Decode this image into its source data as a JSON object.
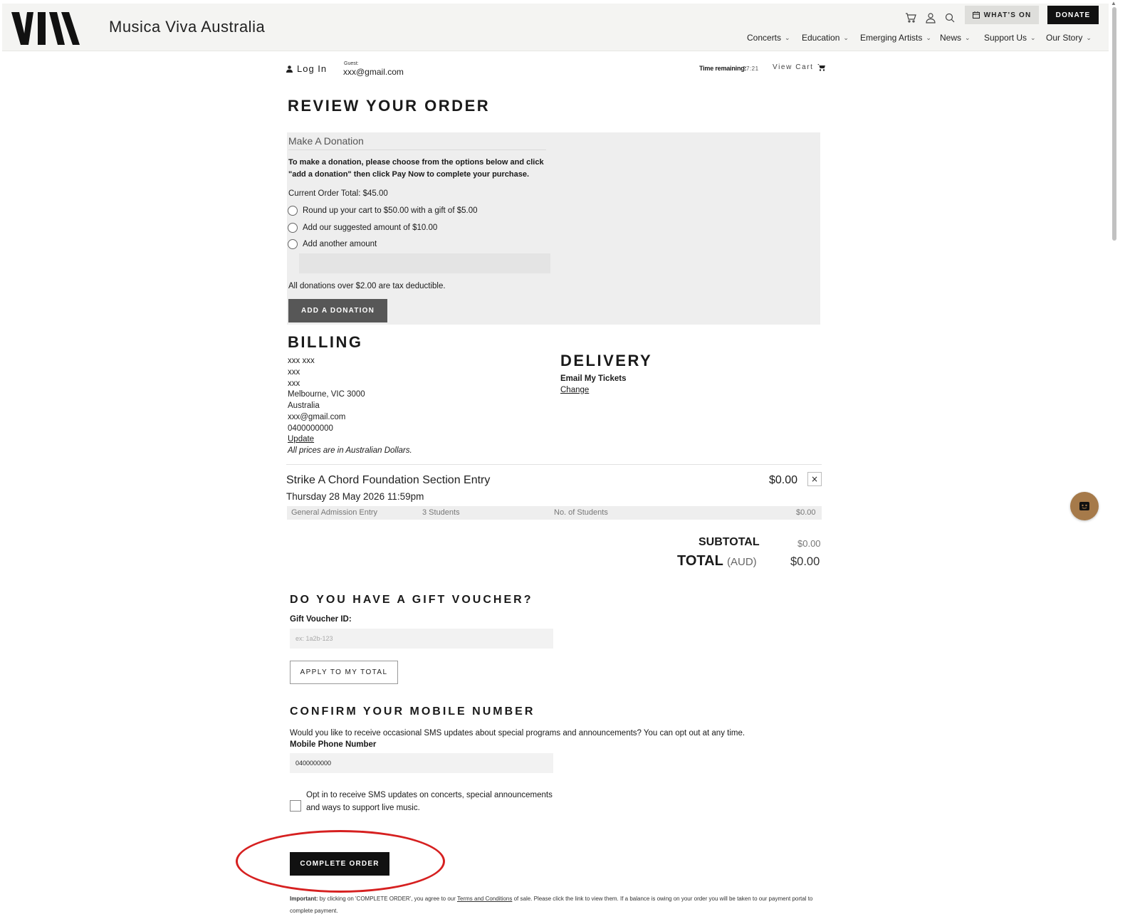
{
  "header": {
    "brand_name": "Musica Viva Australia",
    "whats_on_label": "WHAT'S ON",
    "donate_label": "DONATE",
    "nav": [
      {
        "label": "Concerts"
      },
      {
        "label": "Education"
      },
      {
        "label": "Emerging Artists"
      },
      {
        "label": "News"
      },
      {
        "label": "Support Us"
      },
      {
        "label": "Our Story"
      }
    ],
    "icons": [
      "cart-icon",
      "user-icon",
      "search-icon",
      "calendar-icon"
    ]
  },
  "account": {
    "login_label": "Log In",
    "guest_label": "Guest:",
    "guest_email": "xxx@gmail.com",
    "time_label": "Time remaining:",
    "time_value": "27:21",
    "view_cart_label": "View Cart"
  },
  "page_title": "REVIEW YOUR ORDER",
  "donation": {
    "heading": "Make A Donation",
    "instructions": "To make a donation, please choose from the options below and click \"add a donation\" then click Pay Now to complete your purchase.",
    "current_total": "Current Order Total: $45.00",
    "options": [
      "Round up your cart to $50.00 with a gift of $5.00",
      "Add our suggested amount of $10.00",
      "Add another amount"
    ],
    "other_amount_value": "",
    "tax_note": "All donations over $2.00 are tax deductible.",
    "button_label": "ADD A DONATION"
  },
  "billing": {
    "heading": "BILLING",
    "lines": [
      "xxx xxx",
      "xxx",
      "xxx",
      "Melbourne, VIC 3000",
      "Australia",
      "xxx@gmail.com",
      "0400000000"
    ],
    "update_label": "Update",
    "price_note": "All prices are in Australian Dollars."
  },
  "delivery": {
    "heading": "DELIVERY",
    "method": "Email My Tickets",
    "change_label": "Change"
  },
  "cart_item": {
    "title": "Strike A Chord Foundation Section Entry",
    "date": "Thursday 28 May 2026 11:59pm",
    "price": "$0.00",
    "remove_symbol": "×",
    "ticket_row": {
      "type": "General Admission Entry",
      "quantity": "3 Students",
      "category": "No. of Students",
      "price": "$0.00"
    }
  },
  "totals": {
    "subtotal_label": "SUBTOTAL",
    "subtotal_value": "$0.00",
    "total_label": "TOTAL",
    "currency": "(AUD)",
    "total_value": "$0.00"
  },
  "voucher": {
    "heading": "DO YOU HAVE A GIFT VOUCHER?",
    "label": "Gift Voucher ID:",
    "placeholder": "ex: 1a2b-123",
    "apply_label": "APPLY TO MY TOTAL"
  },
  "mobile": {
    "heading": "CONFIRM YOUR MOBILE NUMBER",
    "question": "Would you like to receive occasional SMS updates about special programs and announcements? You can opt out at any time.",
    "field_label": "Mobile Phone Number",
    "value": "0400000000",
    "optin_text": "Opt in to receive SMS updates on concerts, special announcements and ways to support live music."
  },
  "complete_order_label": "COMPLETE ORDER",
  "legal": {
    "important": "Important:",
    "text_before": " by clicking on 'COMPLETE ORDER', you agree to our ",
    "terms_link": "Terms and Conditions",
    "text_after": " of sale. Please click the link to view them. If a balance is owing on your order you will be taken to our payment portal to complete payment."
  },
  "colors": {
    "accent_dark": "#111111",
    "donation_bg": "#eeeeee",
    "highlight_ring": "#d62020",
    "chat_widget": "#a67a4a"
  }
}
